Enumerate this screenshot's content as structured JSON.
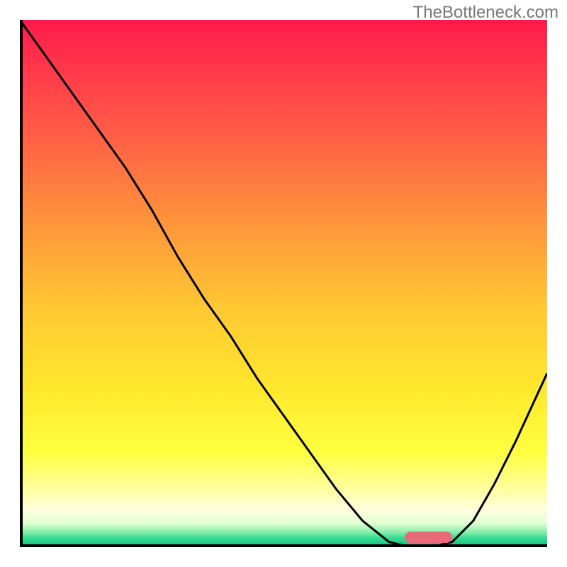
{
  "watermark": "TheBottleneck.com",
  "chart_data": {
    "type": "line",
    "title": "",
    "xlabel": "",
    "ylabel": "",
    "x": [
      0.0,
      0.1,
      0.2,
      0.25,
      0.3,
      0.35,
      0.4,
      0.45,
      0.5,
      0.55,
      0.6,
      0.65,
      0.7,
      0.74,
      0.78,
      0.82,
      0.86,
      0.9,
      0.94,
      1.0
    ],
    "y": [
      1.0,
      0.86,
      0.72,
      0.64,
      0.55,
      0.47,
      0.4,
      0.32,
      0.25,
      0.18,
      0.11,
      0.05,
      0.01,
      0.0,
      0.0,
      0.01,
      0.05,
      0.12,
      0.2,
      0.33
    ],
    "xlim": [
      0,
      1
    ],
    "ylim": [
      0,
      1
    ],
    "marker": {
      "x_start": 0.73,
      "x_end": 0.82,
      "y": 0.0
    },
    "annotations": []
  },
  "colors": {
    "gradient_top": "#ff1a4a",
    "gradient_mid": "#ffe82e",
    "gradient_bottom": "#00c080",
    "curve": "#000000",
    "marker": "#e96a7a"
  }
}
